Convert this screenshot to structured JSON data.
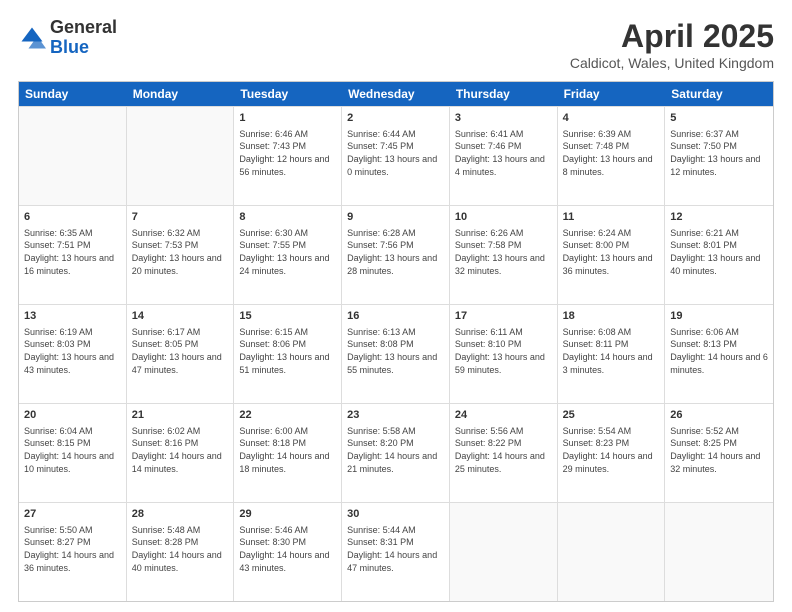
{
  "header": {
    "logo_general": "General",
    "logo_blue": "Blue",
    "main_title": "April 2025",
    "subtitle": "Caldicot, Wales, United Kingdom"
  },
  "days_of_week": [
    "Sunday",
    "Monday",
    "Tuesday",
    "Wednesday",
    "Thursday",
    "Friday",
    "Saturday"
  ],
  "weeks": [
    [
      {
        "day": "",
        "info": ""
      },
      {
        "day": "",
        "info": ""
      },
      {
        "day": "1",
        "info": "Sunrise: 6:46 AM\nSunset: 7:43 PM\nDaylight: 12 hours and 56 minutes."
      },
      {
        "day": "2",
        "info": "Sunrise: 6:44 AM\nSunset: 7:45 PM\nDaylight: 13 hours and 0 minutes."
      },
      {
        "day": "3",
        "info": "Sunrise: 6:41 AM\nSunset: 7:46 PM\nDaylight: 13 hours and 4 minutes."
      },
      {
        "day": "4",
        "info": "Sunrise: 6:39 AM\nSunset: 7:48 PM\nDaylight: 13 hours and 8 minutes."
      },
      {
        "day": "5",
        "info": "Sunrise: 6:37 AM\nSunset: 7:50 PM\nDaylight: 13 hours and 12 minutes."
      }
    ],
    [
      {
        "day": "6",
        "info": "Sunrise: 6:35 AM\nSunset: 7:51 PM\nDaylight: 13 hours and 16 minutes."
      },
      {
        "day": "7",
        "info": "Sunrise: 6:32 AM\nSunset: 7:53 PM\nDaylight: 13 hours and 20 minutes."
      },
      {
        "day": "8",
        "info": "Sunrise: 6:30 AM\nSunset: 7:55 PM\nDaylight: 13 hours and 24 minutes."
      },
      {
        "day": "9",
        "info": "Sunrise: 6:28 AM\nSunset: 7:56 PM\nDaylight: 13 hours and 28 minutes."
      },
      {
        "day": "10",
        "info": "Sunrise: 6:26 AM\nSunset: 7:58 PM\nDaylight: 13 hours and 32 minutes."
      },
      {
        "day": "11",
        "info": "Sunrise: 6:24 AM\nSunset: 8:00 PM\nDaylight: 13 hours and 36 minutes."
      },
      {
        "day": "12",
        "info": "Sunrise: 6:21 AM\nSunset: 8:01 PM\nDaylight: 13 hours and 40 minutes."
      }
    ],
    [
      {
        "day": "13",
        "info": "Sunrise: 6:19 AM\nSunset: 8:03 PM\nDaylight: 13 hours and 43 minutes."
      },
      {
        "day": "14",
        "info": "Sunrise: 6:17 AM\nSunset: 8:05 PM\nDaylight: 13 hours and 47 minutes."
      },
      {
        "day": "15",
        "info": "Sunrise: 6:15 AM\nSunset: 8:06 PM\nDaylight: 13 hours and 51 minutes."
      },
      {
        "day": "16",
        "info": "Sunrise: 6:13 AM\nSunset: 8:08 PM\nDaylight: 13 hours and 55 minutes."
      },
      {
        "day": "17",
        "info": "Sunrise: 6:11 AM\nSunset: 8:10 PM\nDaylight: 13 hours and 59 minutes."
      },
      {
        "day": "18",
        "info": "Sunrise: 6:08 AM\nSunset: 8:11 PM\nDaylight: 14 hours and 3 minutes."
      },
      {
        "day": "19",
        "info": "Sunrise: 6:06 AM\nSunset: 8:13 PM\nDaylight: 14 hours and 6 minutes."
      }
    ],
    [
      {
        "day": "20",
        "info": "Sunrise: 6:04 AM\nSunset: 8:15 PM\nDaylight: 14 hours and 10 minutes."
      },
      {
        "day": "21",
        "info": "Sunrise: 6:02 AM\nSunset: 8:16 PM\nDaylight: 14 hours and 14 minutes."
      },
      {
        "day": "22",
        "info": "Sunrise: 6:00 AM\nSunset: 8:18 PM\nDaylight: 14 hours and 18 minutes."
      },
      {
        "day": "23",
        "info": "Sunrise: 5:58 AM\nSunset: 8:20 PM\nDaylight: 14 hours and 21 minutes."
      },
      {
        "day": "24",
        "info": "Sunrise: 5:56 AM\nSunset: 8:22 PM\nDaylight: 14 hours and 25 minutes."
      },
      {
        "day": "25",
        "info": "Sunrise: 5:54 AM\nSunset: 8:23 PM\nDaylight: 14 hours and 29 minutes."
      },
      {
        "day": "26",
        "info": "Sunrise: 5:52 AM\nSunset: 8:25 PM\nDaylight: 14 hours and 32 minutes."
      }
    ],
    [
      {
        "day": "27",
        "info": "Sunrise: 5:50 AM\nSunset: 8:27 PM\nDaylight: 14 hours and 36 minutes."
      },
      {
        "day": "28",
        "info": "Sunrise: 5:48 AM\nSunset: 8:28 PM\nDaylight: 14 hours and 40 minutes."
      },
      {
        "day": "29",
        "info": "Sunrise: 5:46 AM\nSunset: 8:30 PM\nDaylight: 14 hours and 43 minutes."
      },
      {
        "day": "30",
        "info": "Sunrise: 5:44 AM\nSunset: 8:31 PM\nDaylight: 14 hours and 47 minutes."
      },
      {
        "day": "",
        "info": ""
      },
      {
        "day": "",
        "info": ""
      },
      {
        "day": "",
        "info": ""
      }
    ]
  ]
}
